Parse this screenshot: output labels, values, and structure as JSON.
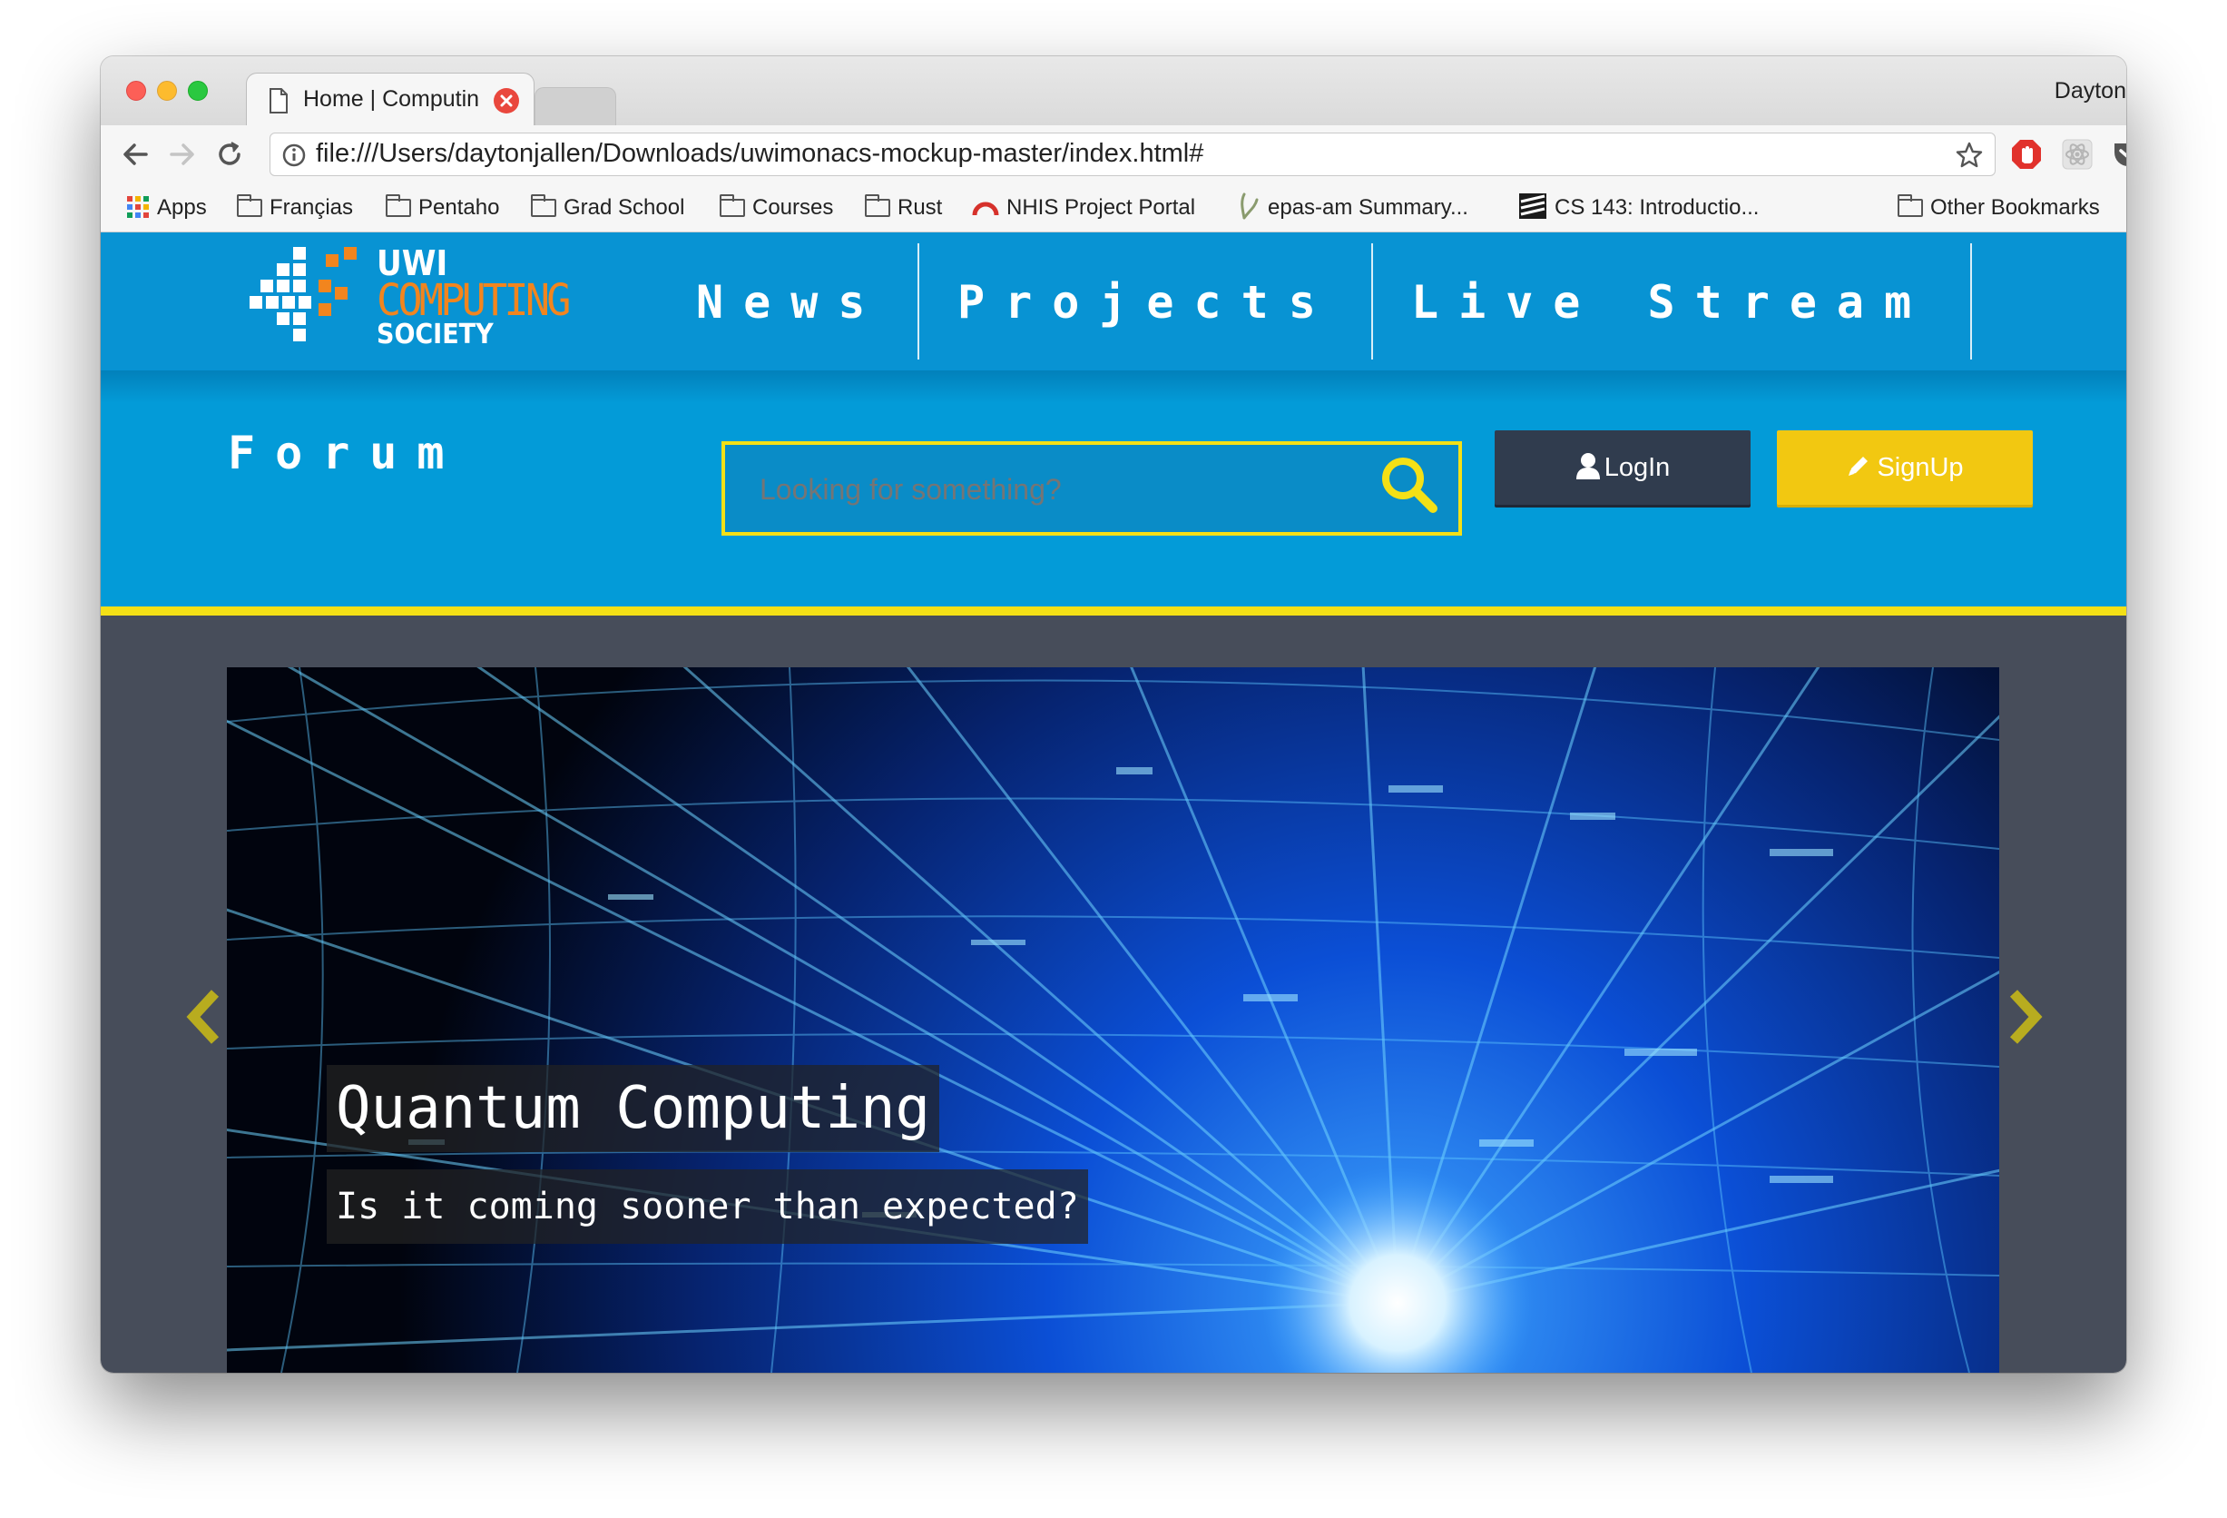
{
  "browser": {
    "tab_title": "Home | Computin",
    "profile_name": "Dayton",
    "address": "file:///Users/daytonjallen/Downloads/uwimonacs-mockup-master/index.html#",
    "bookmarks": [
      "Apps",
      "Françias",
      "Pentaho",
      "Grad School",
      "Courses",
      "Rust",
      "NHIS Project Portal",
      "epas-am Summary...",
      "CS 143: Introductio..."
    ],
    "other_bookmarks": "Other Bookmarks"
  },
  "site": {
    "logo": {
      "line1": "UWI",
      "line2": "COMPUTING",
      "line3": "SOCIETY"
    },
    "nav": [
      "News",
      "Projects",
      "Live Stream"
    ],
    "forum_label": "Forum",
    "search": {
      "placeholder": "Looking for something?"
    },
    "login_label": "LogIn",
    "signup_label": "SignUp",
    "hero": {
      "title": "Quantum Computing",
      "subtitle": "Is it coming sooner than expected?"
    }
  },
  "colors": {
    "nav_blue": "#0893d3",
    "sub_blue": "#039bd8",
    "accent_yellow": "#f4e016",
    "signup_yellow": "#f2c811",
    "login_dark": "#303c4e",
    "logo_orange": "#f2851e",
    "stage_gray": "#474d5a"
  }
}
